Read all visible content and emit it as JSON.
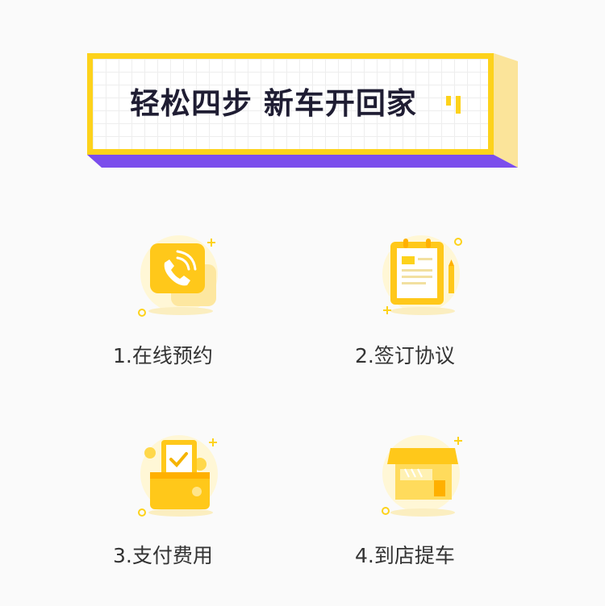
{
  "banner": {
    "title": "轻松四步 新车开回家"
  },
  "steps": [
    {
      "label": "1.在线预约",
      "icon": "phone-icon"
    },
    {
      "label": "2.签订协议",
      "icon": "agreement-icon"
    },
    {
      "label": "3.支付费用",
      "icon": "wallet-payment-icon"
    },
    {
      "label": "4.到店提车",
      "icon": "store-pickup-icon"
    }
  ],
  "colors": {
    "accent_yellow": "#fdd21b",
    "accent_purple": "#7b4dec",
    "title_text": "#1f1d33"
  }
}
